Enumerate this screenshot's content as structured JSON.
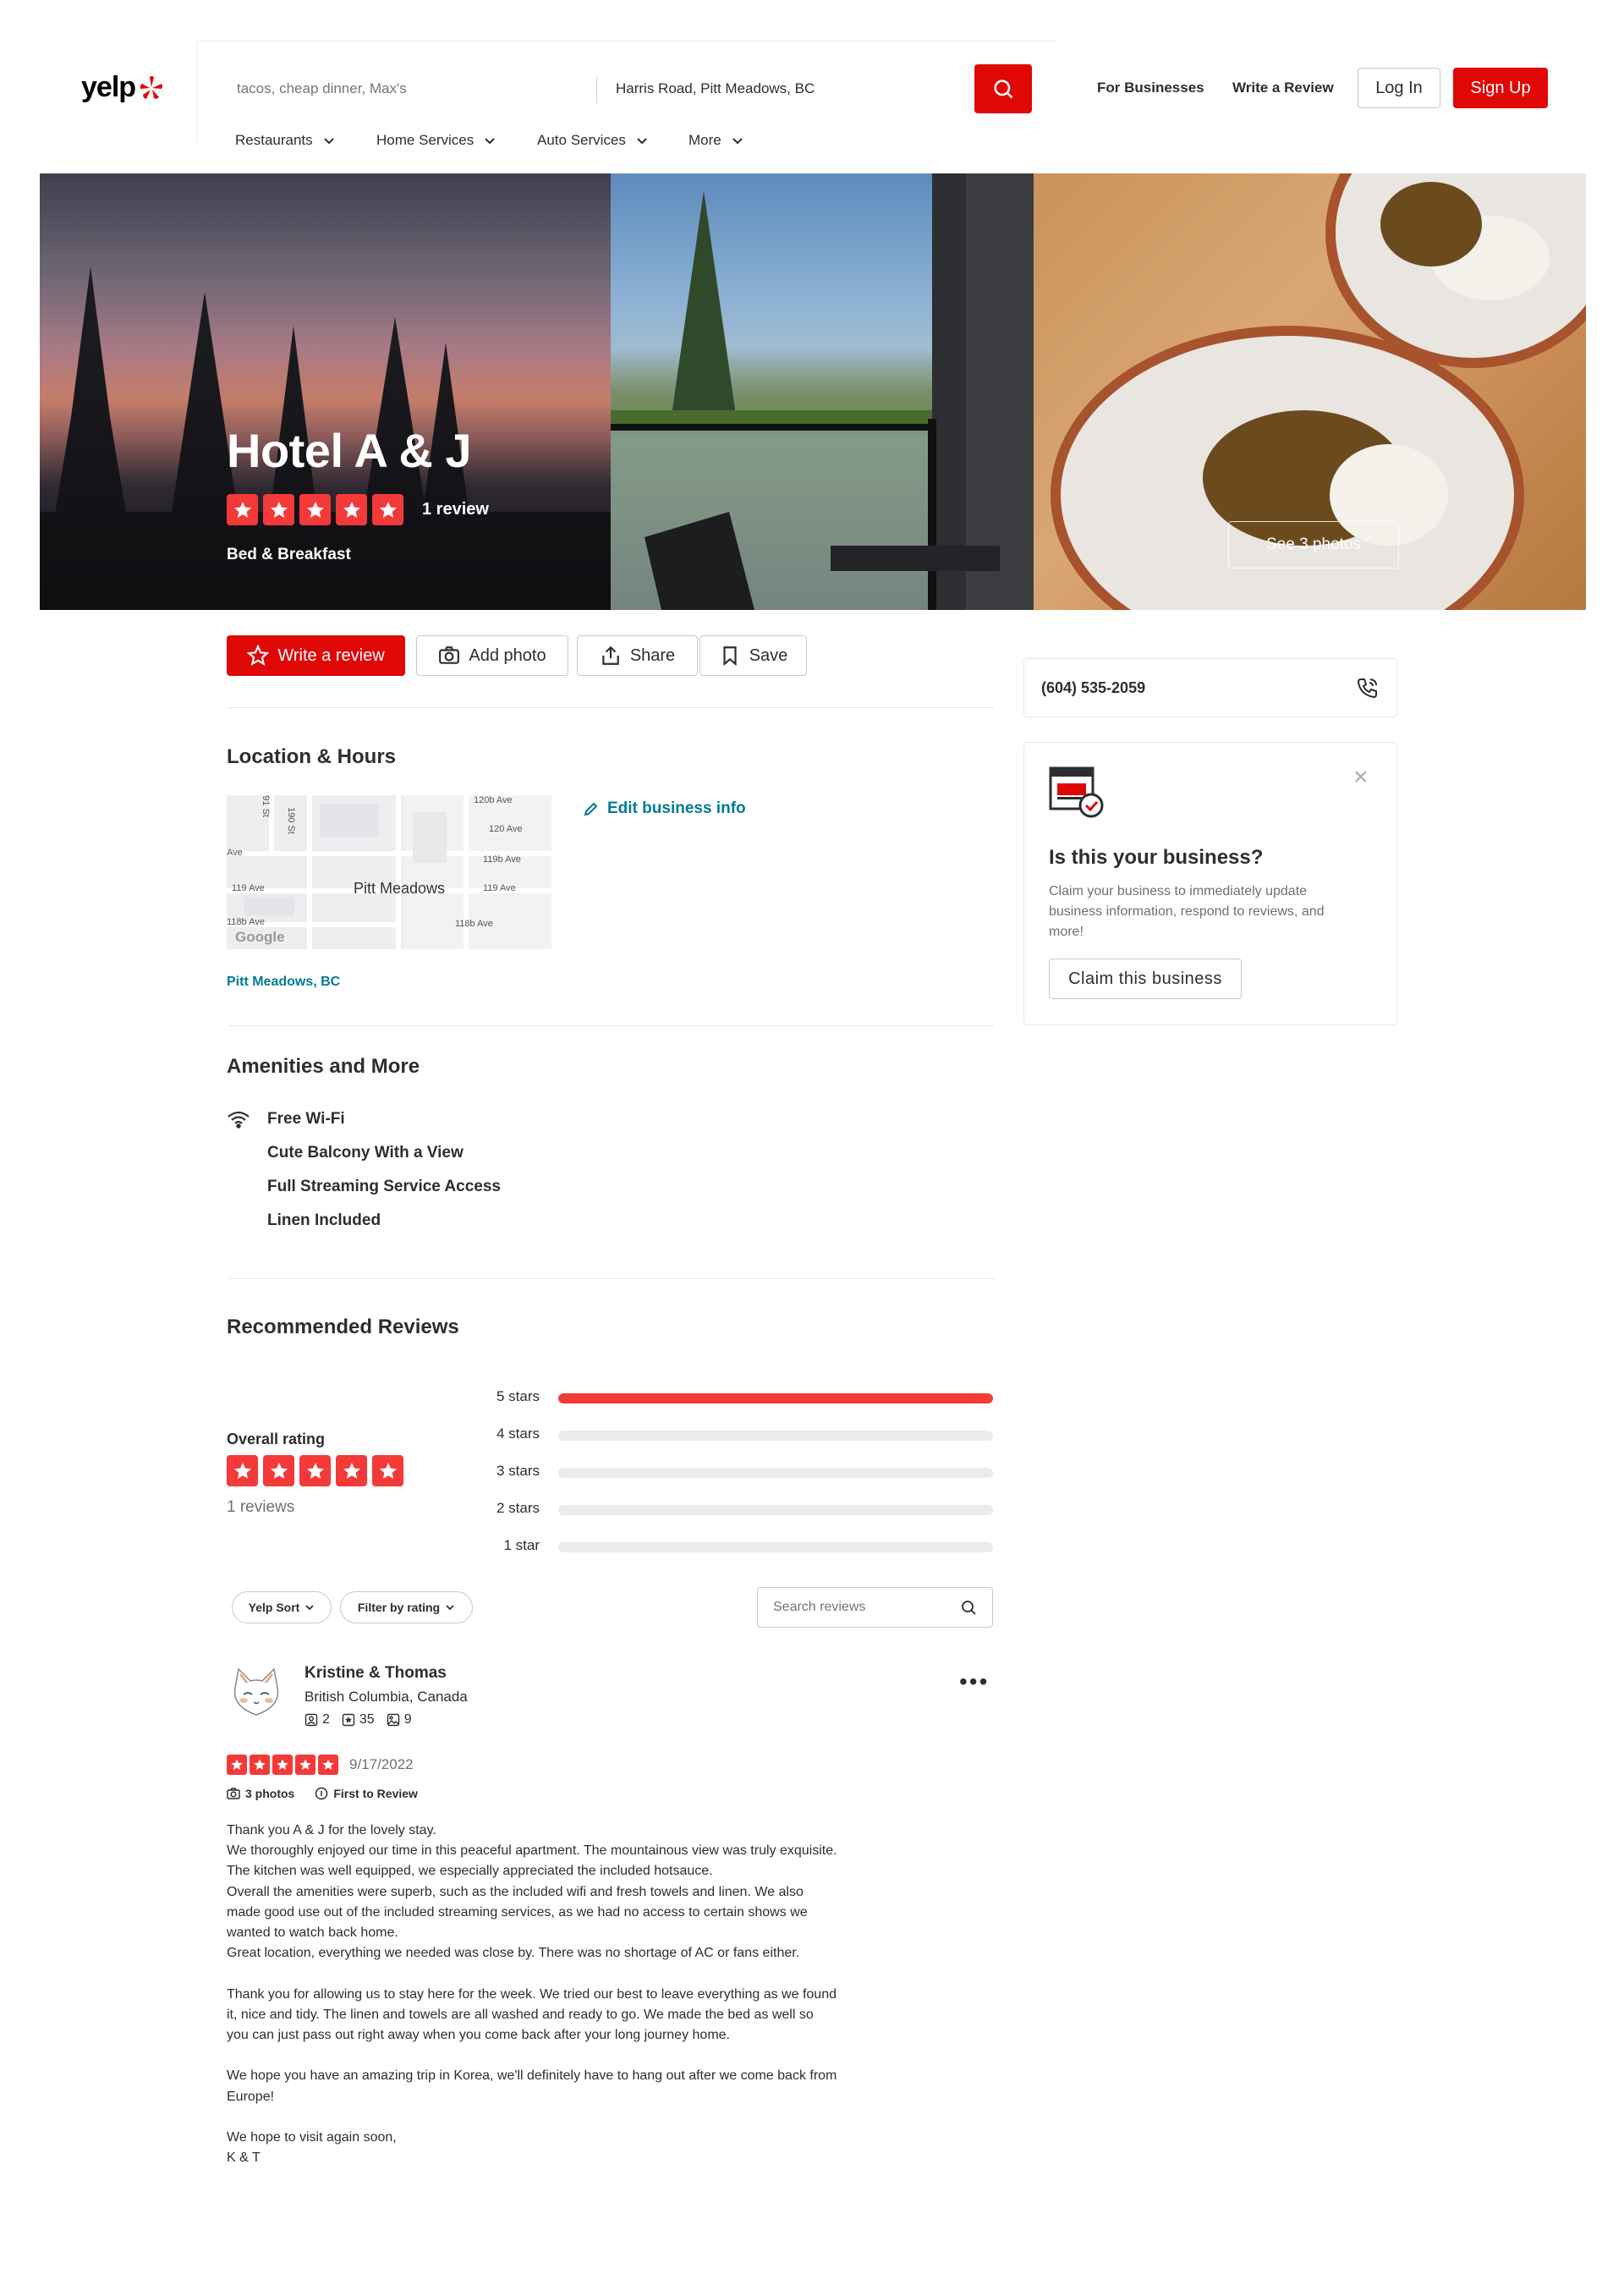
{
  "header": {
    "logo_text": "yelp",
    "search_placeholder": "tacos, cheap dinner, Max's",
    "location_value": "Harris Road, Pitt Meadows, BC",
    "for_businesses": "For Businesses",
    "write_review": "Write a Review",
    "log_in": "Log In",
    "sign_up": "Sign Up",
    "nav": [
      "Restaurants",
      "Home Services",
      "Auto Services",
      "More"
    ]
  },
  "business": {
    "name": "Hotel A & J",
    "rating": 5,
    "review_count_label": "1 review",
    "category": "Bed & Breakfast",
    "see_photos": "See 3 photos"
  },
  "actions": {
    "write_review": "Write a review",
    "add_photo": "Add photo",
    "share": "Share",
    "save": "Save"
  },
  "location": {
    "title": "Location & Hours",
    "edit_info": "Edit business info",
    "city": "Pitt Meadows, BC",
    "map": {
      "city_label": "Pitt Meadows",
      "street_labels": [
        "120b Ave",
        "120 Ave",
        "119b Ave",
        "119 Ave",
        "118b Ave",
        "119 Ave",
        "118b Ave",
        "190 St",
        "191 St",
        "Ave"
      ],
      "attribution": "Google"
    }
  },
  "amenities": {
    "title": "Amenities and More",
    "items": [
      "Free Wi-Fi",
      "Cute Balcony With a View",
      "Full Streaming Service Access",
      "Linen Included"
    ]
  },
  "reviews": {
    "title": "Recommended Reviews",
    "overall_label": "Overall rating",
    "overall_count": "1 reviews",
    "chart_data": {
      "type": "bar",
      "categories": [
        "5 stars",
        "4 stars",
        "3 stars",
        "2 stars",
        "1 star"
      ],
      "values": [
        1,
        0,
        0,
        0,
        0
      ]
    },
    "sort_label": "Yelp Sort",
    "filter_label": "Filter by rating",
    "search_placeholder": "Search reviews",
    "items": [
      {
        "author": "Kristine & Thomas",
        "location": "British Columbia, Canada",
        "friends": "2",
        "reviews": "35",
        "photos": "9",
        "rating": 5,
        "date": "9/17/2022",
        "photo_count": "3 photos",
        "first_badge": "First to Review",
        "text": [
          "Thank you A & J for the lovely stay.",
          "We thoroughly enjoyed our time in this peaceful apartment. The mountainous view was truly exquisite.",
          "The kitchen was well equipped, we especially appreciated the included hotsauce.",
          "Overall the amenities were superb, such as the included wifi and fresh towels and linen. We also",
          "made good use out of the included streaming services, as we had no access to certain shows we",
          "wanted to watch back home.",
          "Great location, everything we needed was close by. There was no shortage of AC or fans either.",
          "",
          "Thank you for allowing us to stay here for the week. We tried our best to leave everything as we found",
          "it, nice and tidy. The linen and towels are all washed and ready to go. We made the bed as well so",
          "you can just pass out right away when you come back after your long journey home.",
          "",
          "We hope you have an amazing trip in Korea, we'll definitely have to hang out after we come back from",
          "Europe!",
          "",
          "We hope to visit again soon,",
          "K & T"
        ]
      }
    ]
  },
  "sidebar": {
    "phone": "(604) 535-2059",
    "claim_title": "Is this your business?",
    "claim_desc": "Claim your business to immediately update business information, respond to reviews, and more!",
    "claim_button": "Claim this business"
  },
  "colors": {
    "brand_red": "#e00707",
    "star_red": "#f43939",
    "link_teal": "#027a97"
  }
}
